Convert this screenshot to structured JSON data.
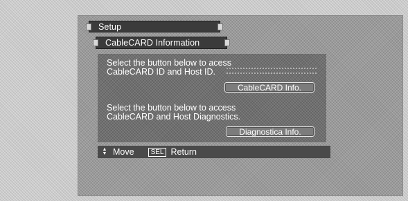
{
  "menu": {
    "title": "Setup",
    "submenu_title": "CableCARD Information"
  },
  "panel": {
    "section1_line1": "Select the button below to acess",
    "section1_line2": "CableCARD ID and Host ID.",
    "cablecard_button": "CableCARD Info.",
    "section2_line1": "Select the button below to access",
    "section2_line2": "CableCARD and Host Diagnostics.",
    "diagnostics_button": "Diagnostica Info."
  },
  "footer": {
    "move_icon": "up-down-arrows-icon",
    "move_label": "Move",
    "sel_key": "SEL",
    "return_label": "Return"
  },
  "colors": {
    "bar": "#3b3b3b",
    "panel": "#6f6f6f",
    "text": "#ffffff"
  }
}
